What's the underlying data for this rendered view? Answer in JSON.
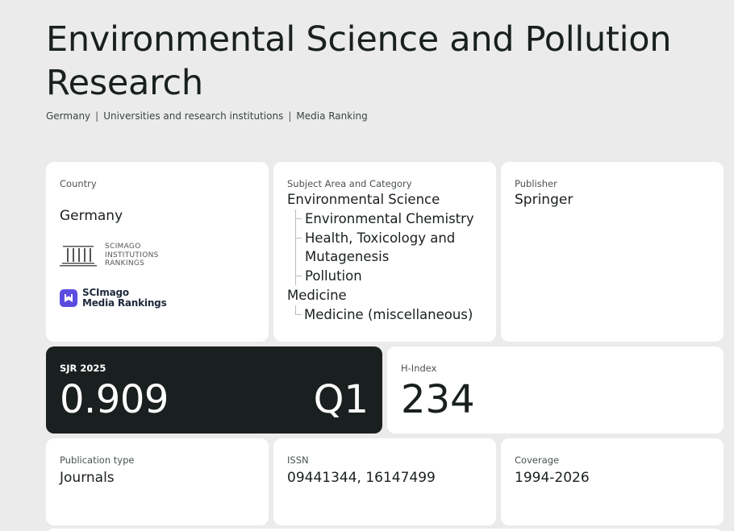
{
  "header": {
    "title": "Environmental Science and Pollution Research",
    "breadcrumb": [
      "Germany",
      "Universities and research institutions",
      "Media Ranking"
    ]
  },
  "country_card": {
    "label": "Country",
    "value": "Germany",
    "institutions_logo": [
      "SCIMAGO",
      "INSTITUTIONS",
      "RANKINGS"
    ],
    "media_logo": [
      "SCImago",
      "Media Rankings"
    ]
  },
  "subject_card": {
    "label": "Subject Area and Category",
    "areas": [
      {
        "name": "Environmental Science",
        "categories": [
          "Environmental Chemistry",
          "Health, Toxicology and Mutagenesis",
          "Pollution"
        ]
      },
      {
        "name": "Medicine",
        "categories": [
          "Medicine (miscellaneous)"
        ]
      }
    ]
  },
  "publisher_card": {
    "label": "Publisher",
    "value": "Springer"
  },
  "sjr_card": {
    "label": "SJR 2025",
    "value": "0.909",
    "quartile": "Q1"
  },
  "hindex_card": {
    "label": "H-Index",
    "value": "234"
  },
  "pubtype_card": {
    "label": "Publication type",
    "value": "Journals"
  },
  "issn_card": {
    "label": "ISSN",
    "value": "09441344, 16147499"
  },
  "coverage_card": {
    "label": "Coverage",
    "value": "1994-2026"
  },
  "colors": {
    "background": "#ebebeb",
    "card": "#ffffff",
    "dark_card": "#1a1f1f",
    "media_accent": "#5b4ce0"
  }
}
